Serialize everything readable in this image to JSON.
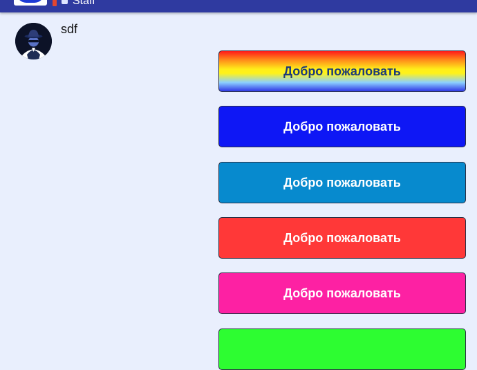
{
  "header": {
    "role_label": "Staff"
  },
  "post": {
    "username": "sdf"
  },
  "buttons": [
    {
      "label": "Добро пожаловать",
      "style": "rainbow",
      "color": "#ffee1a"
    },
    {
      "label": "Добро пожаловать",
      "style": "solid",
      "color": "#0e17f5"
    },
    {
      "label": "Добро пожаловать",
      "style": "solid",
      "color": "#078ace"
    },
    {
      "label": "Добро пожаловать",
      "style": "solid",
      "color": "#ff3838"
    },
    {
      "label": "Добро пожаловать",
      "style": "solid",
      "color": "#fd21a3"
    },
    {
      "label": "",
      "style": "solid",
      "color": "#2dfd31"
    }
  ]
}
